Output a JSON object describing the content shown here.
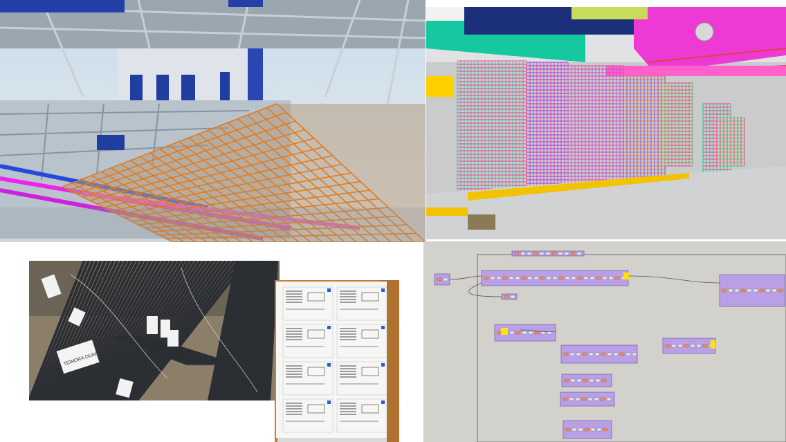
{
  "images": [
    {
      "name": "rebar-mesh-render"
    },
    {
      "name": "rebar-cage-bim-view"
    },
    {
      "name": "rebar-bundle-photo"
    },
    {
      "name": "bending-schedule-sheets"
    },
    {
      "name": "node-graph-editor"
    }
  ],
  "photo_tags": {
    "tag_1": "TEINORA DUAETE"
  }
}
